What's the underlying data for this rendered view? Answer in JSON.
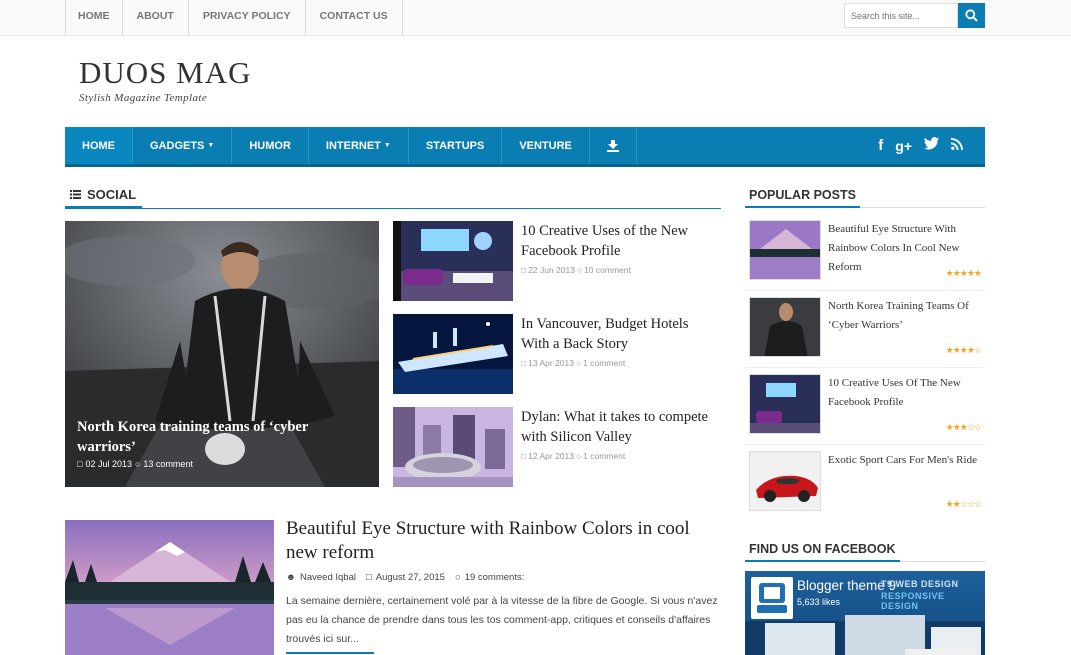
{
  "top_nav": [
    "HOME",
    "ABOUT",
    "PRIVACY POLICY",
    "CONTACT US"
  ],
  "search": {
    "placeholder": "Search this site..."
  },
  "header": {
    "title": "DUOS MAG",
    "tagline": "Stylish Magazine Template"
  },
  "main_nav": [
    {
      "label": "HOME",
      "active": true,
      "dropdown": false
    },
    {
      "label": "GADGETS",
      "active": false,
      "dropdown": true
    },
    {
      "label": "HUMOR",
      "active": false,
      "dropdown": false
    },
    {
      "label": "INTERNET",
      "active": false,
      "dropdown": true
    },
    {
      "label": "STARTUPS",
      "active": false,
      "dropdown": false
    },
    {
      "label": "VENTURE",
      "active": false,
      "dropdown": false
    }
  ],
  "social_icons": [
    "facebook-icon",
    "google-plus-icon",
    "twitter-icon",
    "rss-icon"
  ],
  "section": {
    "label": "SOCIAL"
  },
  "featured": {
    "title": "North Korea training teams of ‘cyber warriors’",
    "date": "02 Jul 2013",
    "comments": "13 comment"
  },
  "side_posts": [
    {
      "title": "10 Creative Uses of the New Facebook Profile",
      "date": "22 Jun 2013",
      "comments": "10 comment"
    },
    {
      "title": "In Vancouver, Budget Hotels With a Back Story",
      "date": "13 Apr 2013",
      "comments": "1 comment"
    },
    {
      "title": "Dylan: What it takes to compete with Silicon Valley",
      "date": "12 Apr 2013",
      "comments": "1 comment"
    }
  ],
  "big_post": {
    "title": "Beautiful Eye Structure with Rainbow Colors in cool new reform",
    "author": "Naveed Iqbal",
    "date": "August 27, 2015",
    "comments": "19 comments:",
    "excerpt": "La semaine dernière, certainement volé par à la vitesse de la fibre de Google. Si vous n'avez pas eu la chance de prendre dans tous les tos comment-app, critiques et conseils d'affaires trouvés ici sur..."
  },
  "popular": {
    "heading": "POPULAR POSTS",
    "items": [
      {
        "title": "Beautiful Eye Structure With Rainbow Colors In Cool New Reform",
        "rating": 5
      },
      {
        "title": "North Korea Training Teams Of ‘Cyber Warriors’",
        "rating": 4
      },
      {
        "title": "10 Creative Uses Of The New Facebook Profile",
        "rating": 3
      },
      {
        "title": "Exotic Sport Cars For Men's Ride",
        "rating": 2
      }
    ]
  },
  "facebook": {
    "heading": "FIND US ON FACEBOOK",
    "page_name": "Blogger theme 9",
    "likes": "5,633 likes",
    "banner_line1": "T9 WEB DESIGN",
    "banner_line2": "RESPONSIVE DESIGN"
  },
  "colors": {
    "accent": "#0a7db2",
    "star": "#f5a623"
  }
}
